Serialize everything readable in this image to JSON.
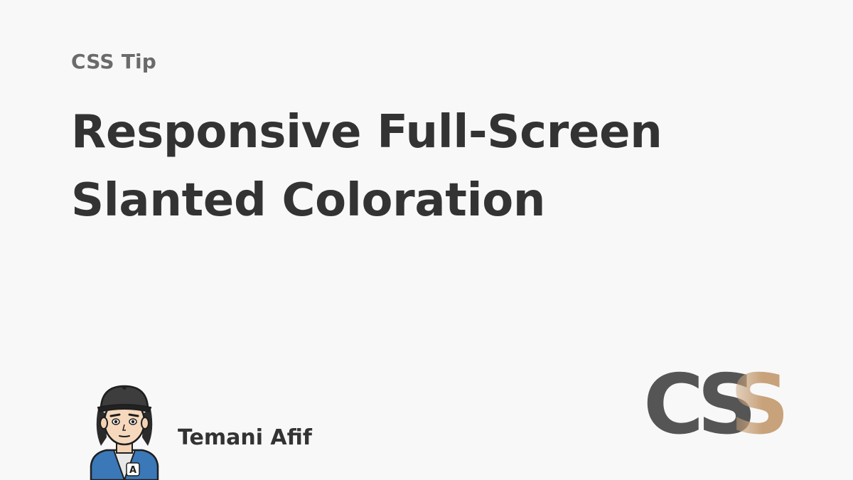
{
  "eyebrow": "CSS Tip",
  "headline": {
    "line1": "Responsive Full-Screen",
    "line2": "Slanted Coloration"
  },
  "author": {
    "name": "Temani Afif",
    "avatar_icon": "cartoon-avatar-icon",
    "jacket_letter": "A"
  },
  "logo": {
    "letters": [
      "C",
      "S",
      "S"
    ],
    "icon": "css-logo-icon"
  },
  "colors": {
    "background": "#f8f8f8",
    "eyebrow": "#6b6b6b",
    "headline": "#333333",
    "author": "#333333",
    "logo_dark": "#555555",
    "logo_accent": "#c8a27a",
    "jacket_blue": "#3a78b8"
  }
}
